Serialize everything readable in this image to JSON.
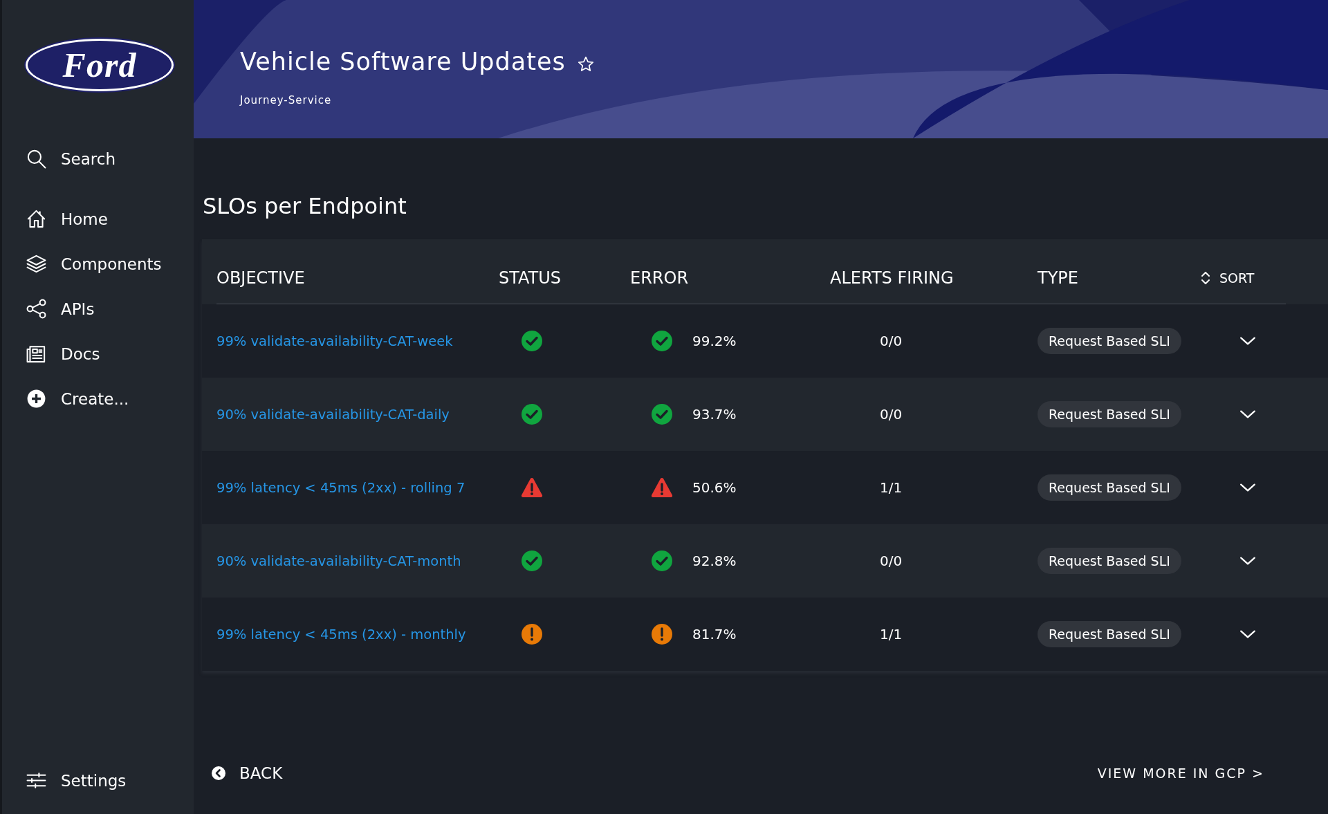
{
  "sidebar": {
    "logo": "Ford",
    "items": [
      {
        "label": "Search"
      },
      {
        "label": "Home"
      },
      {
        "label": "Components"
      },
      {
        "label": "APIs"
      },
      {
        "label": "Docs"
      },
      {
        "label": "Create..."
      }
    ],
    "settings": {
      "label": "Settings"
    }
  },
  "header": {
    "title": "Vehicle Software Updates",
    "favorite": false,
    "subtitle": "Journey-Service"
  },
  "section_title": "SLOs per Endpoint",
  "table": {
    "columns": [
      "OBJECTIVE",
      "STATUS",
      "ERROR",
      "ALERTS FIRING",
      "TYPE"
    ],
    "sort": "SORT",
    "rows": [
      {
        "objective": "99% validate-availability-CAT-week",
        "status": {
          "kind": "ok"
        },
        "error_status": {
          "kind": "ok"
        },
        "error": "99.2%",
        "alerts": "0/0",
        "type": "Request Based SLI",
        "expanded": false
      },
      {
        "objective": "90% validate-availability-CAT-daily",
        "status": {
          "kind": "ok"
        },
        "error_status": {
          "kind": "ok"
        },
        "error": "93.7%",
        "alerts": "0/0",
        "type": "Request Based SLI",
        "expanded": false
      },
      {
        "objective": "99% latency < 45ms (2xx) - rolling 7",
        "status": {
          "kind": "critical"
        },
        "error_status": {
          "kind": "critical"
        },
        "error": "50.6%",
        "alerts": "1/1",
        "type": "Request Based SLI",
        "expanded": false
      },
      {
        "objective": "90% validate-availability-CAT-month",
        "status": {
          "kind": "ok"
        },
        "error_status": {
          "kind": "ok"
        },
        "error": "92.8%",
        "alerts": "0/0",
        "type": "Request Based SLI",
        "expanded": false
      },
      {
        "objective": "99% latency < 45ms (2xx) - monthly",
        "status": {
          "kind": "warning"
        },
        "error_status": {
          "kind": "warning"
        },
        "error": "81.7%",
        "alerts": "1/1",
        "type": "Request Based SLI",
        "expanded": false
      }
    ]
  },
  "footer": {
    "back": "BACK",
    "more": "VIEW MORE IN GCP >"
  }
}
